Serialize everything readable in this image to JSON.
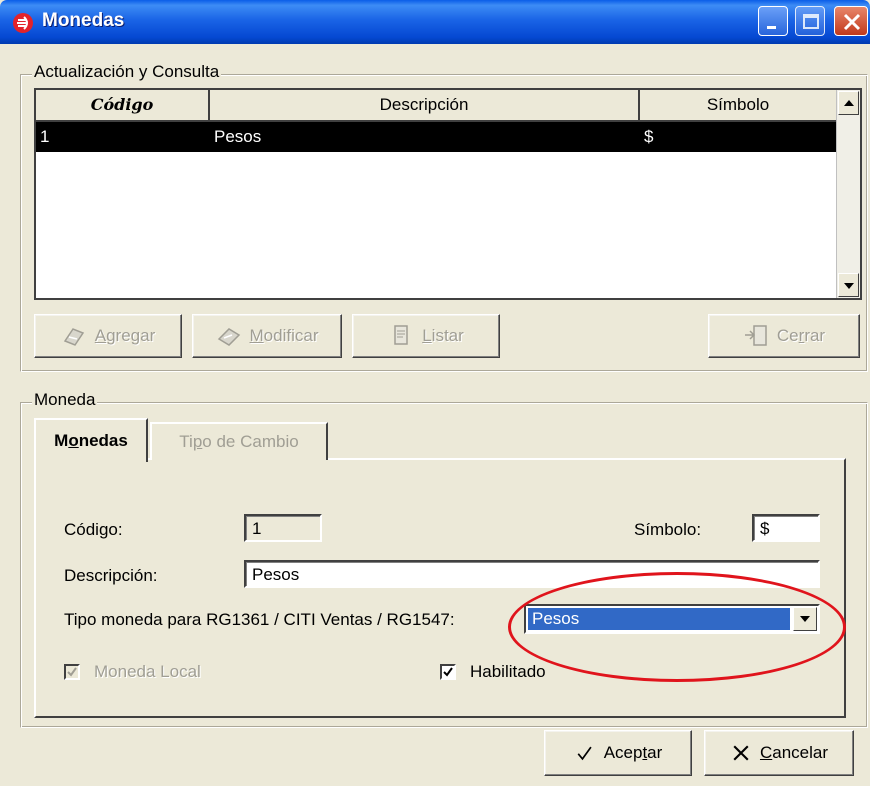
{
  "window": {
    "title": "Monedas",
    "controls": [
      "minimize-icon",
      "maximize-icon",
      "close-icon"
    ]
  },
  "update_group": {
    "label": "Actualización y Consulta",
    "grid": {
      "columns": [
        "Código",
        "Descripción",
        "Símbolo"
      ],
      "rows": [
        {
          "codigo": "1",
          "descripcion": "Pesos",
          "simbolo": "$"
        }
      ]
    },
    "buttons": {
      "agregar": {
        "pre": "",
        "key": "A",
        "post": "gregar",
        "enabled": false
      },
      "modificar": {
        "pre": "",
        "key": "M",
        "post": "odificar",
        "enabled": false
      },
      "listar": {
        "pre": "",
        "key": "L",
        "post": "istar",
        "enabled": false
      },
      "cerrar": {
        "pre": "Ce",
        "key": "r",
        "post": "rar",
        "enabled": false
      }
    }
  },
  "moneda_group": {
    "label": "Moneda",
    "tabs": [
      {
        "pre": "M",
        "key": "o",
        "post": "nedas",
        "active": true
      },
      {
        "pre": "Ti",
        "key": "p",
        "post": "o de Cambio",
        "active": false
      }
    ],
    "form": {
      "codigo_label": "Código:",
      "codigo_value": "1",
      "simbolo_label": "Símbolo:",
      "simbolo_value": "$",
      "descripcion_label": "Descripción:",
      "descripcion_value": "Pesos",
      "tipo_label": "Tipo moneda para RG1361 / CITI Ventas / RG1547:",
      "tipo_value": "Pesos",
      "moneda_local_label": "Moneda Local",
      "moneda_local_checked": true,
      "moneda_local_enabled": false,
      "habilitado_label": "Habilitado",
      "habilitado_checked": true
    }
  },
  "footer": {
    "aceptar": {
      "pre": "Acep",
      "key": "t",
      "post": "ar"
    },
    "cancelar": {
      "pre": "",
      "key": "C",
      "post": "ancelar"
    }
  },
  "colors": {
    "titlebar": "#0548d2",
    "selection": "#3169c6",
    "annotation_ellipse": "#e0141c"
  }
}
